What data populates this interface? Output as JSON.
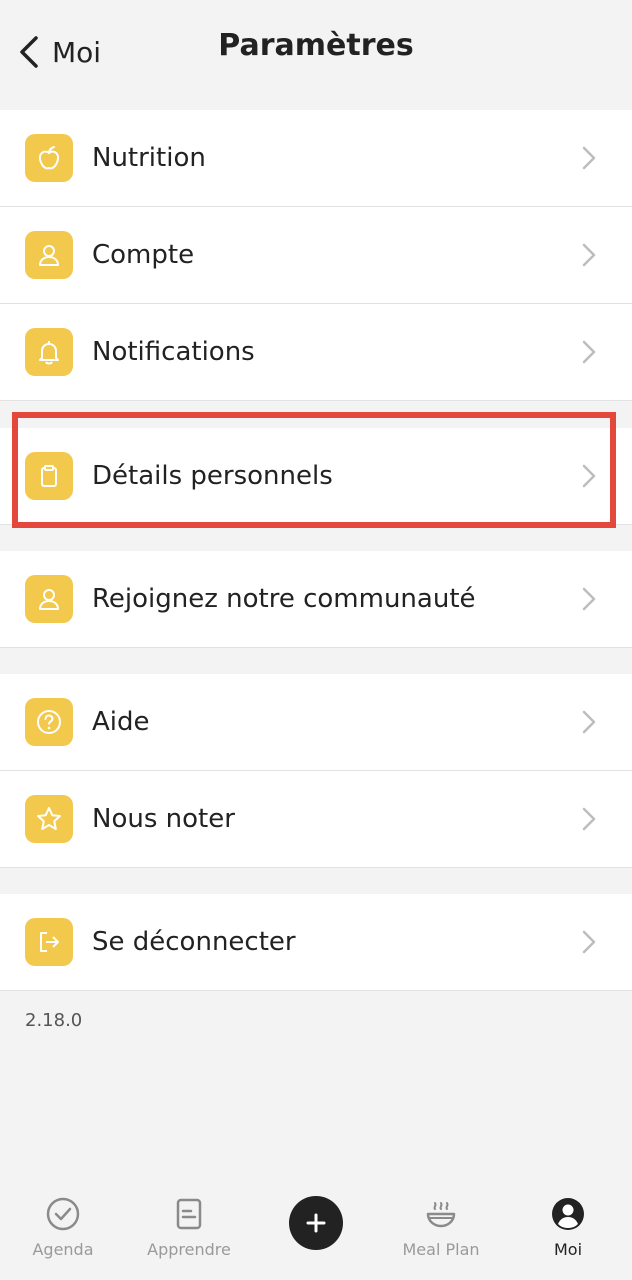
{
  "header": {
    "back_label": "Moi",
    "title": "Paramètres"
  },
  "groups": [
    {
      "items": [
        {
          "label": "Nutrition",
          "icon": "apple-icon"
        },
        {
          "label": "Compte",
          "icon": "user-icon"
        },
        {
          "label": "Notifications",
          "icon": "bell-icon"
        }
      ]
    },
    {
      "items": [
        {
          "label": "Détails personnels",
          "icon": "clipboard-icon"
        }
      ]
    },
    {
      "items": [
        {
          "label": "Rejoignez notre communauté",
          "icon": "user-icon"
        }
      ]
    },
    {
      "items": [
        {
          "label": "Aide",
          "icon": "help-circle-icon"
        },
        {
          "label": "Nous noter",
          "icon": "star-icon"
        }
      ]
    },
    {
      "items": [
        {
          "label": "Se déconnecter",
          "icon": "logout-icon"
        }
      ]
    }
  ],
  "version": "2.18.0",
  "tabbar": {
    "tabs": [
      {
        "label": "Agenda",
        "icon": "check-circle-icon",
        "active": false
      },
      {
        "label": "Apprendre",
        "icon": "document-icon",
        "active": false
      },
      {
        "label": "Meal Plan",
        "icon": "bowl-icon",
        "active": false
      },
      {
        "label": "Moi",
        "icon": "profile-icon",
        "active": true
      }
    ],
    "add_icon": "plus-icon"
  },
  "colors": {
    "accent": "#f2c94c",
    "highlight": "#e4473c",
    "background": "#f3f3f3"
  }
}
